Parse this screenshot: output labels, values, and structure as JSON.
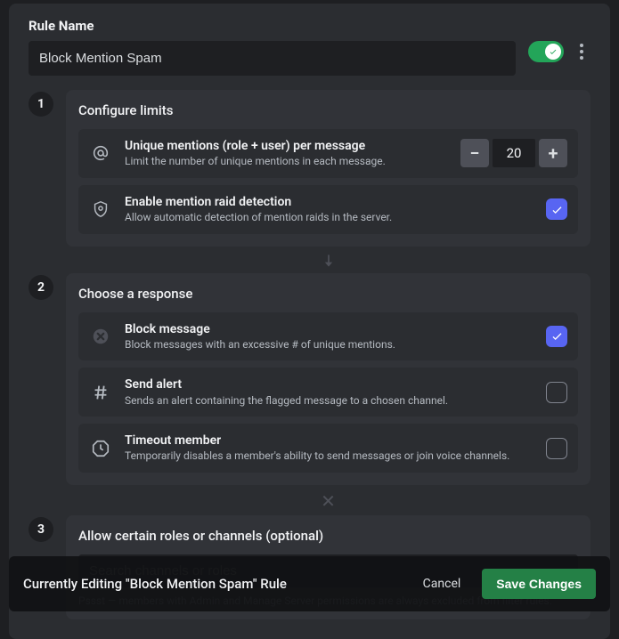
{
  "header": {
    "label": "Rule Name",
    "value": "Block Mention Spam"
  },
  "step1": {
    "title": "Configure limits",
    "mentions": {
      "title": "Unique mentions (role + user) per message",
      "desc": "Limit the number of unique mentions in each message.",
      "value": "20"
    },
    "raid": {
      "title": "Enable mention raid detection",
      "desc": "Allow automatic detection of mention raids in the server."
    }
  },
  "step2": {
    "title": "Choose a response",
    "block": {
      "title": "Block message",
      "desc": "Block messages with an excessive # of unique mentions."
    },
    "alert": {
      "title": "Send alert",
      "desc": "Sends an alert containing the flagged message to a chosen channel."
    },
    "timeout": {
      "title": "Timeout member",
      "desc": "Temporarily disables a member's ability to send messages or join voice channels."
    }
  },
  "step3": {
    "title": "Allow certain roles or channels (optional)",
    "placeholder": "Search channels or roles",
    "hint": "Pssst — members with Admin and Manage Server permissions are always excluded from filter rules."
  },
  "footer": {
    "text": "Currently Editing \"Block Mention Spam\" Rule",
    "cancel": "Cancel",
    "save": "Save Changes"
  }
}
